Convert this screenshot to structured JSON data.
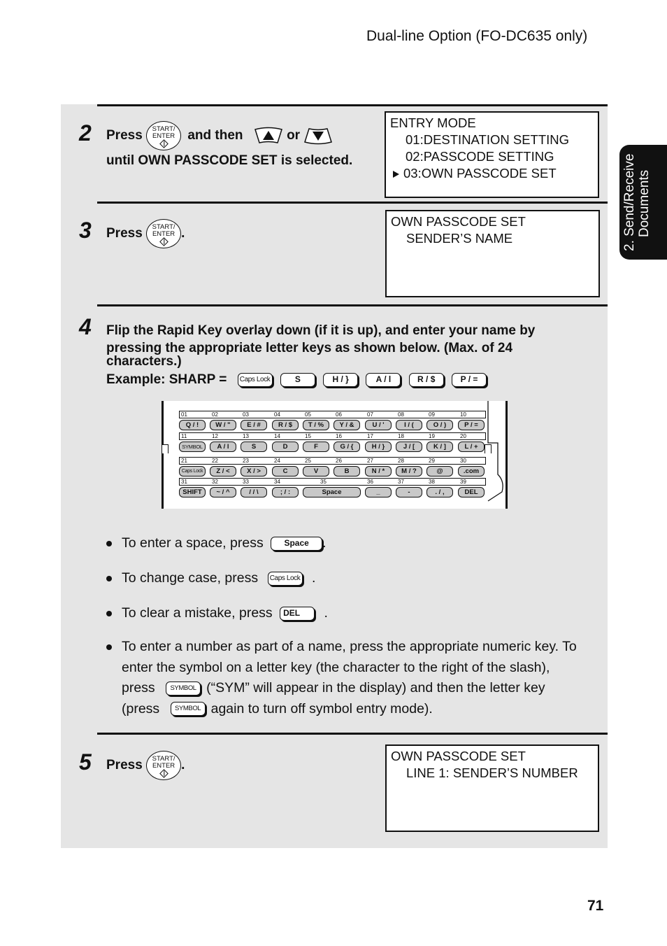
{
  "header": {
    "title": "Dual-line Option (FO-DC635 only)"
  },
  "side_tab": {
    "line1": "2. Send/Receive",
    "line2": "Documents"
  },
  "page_number": "71",
  "steps": [
    {
      "number": "2",
      "text_press": "Press",
      "start_key": {
        "line1": "START/",
        "line2": "ENTER"
      },
      "text_and_then": "and then",
      "text_or": "or",
      "text_line2": "until OWN PASSCODE SET is selected.",
      "display": {
        "line1": "ENTRY MODE",
        "line2": "01:DESTINATION SETTING",
        "line3": "02:PASSCODE SETTING",
        "line4": "03:OWN PASSCODE SET"
      }
    },
    {
      "number": "3",
      "text_press": "Press",
      "start_key": {
        "line1": "START/",
        "line2": "ENTER"
      },
      "period": ".",
      "display": {
        "line1": "OWN PASSCODE SET",
        "line2": "SENDER’S NAME"
      }
    },
    {
      "number": "4",
      "text": "Flip the Rapid Key overlay down (if it is up), and enter your name by pressing the appropriate letter keys as shown below. (Max. of 24 characters.)",
      "text_line1": "Flip the Rapid Key overlay down (if it is up), and enter your name by",
      "text_line2": "pressing the appropriate letter keys as shown below. (Max. of 24",
      "text_line3": "characters.)",
      "example_label": "Example: SHARP =",
      "example_keys": [
        "Caps Lock",
        "S",
        "H / }",
        "A / l",
        "R / $",
        "P / ="
      ]
    },
    {
      "number": "5",
      "text_press": "Press",
      "start_key": {
        "line1": "START/",
        "line2": "ENTER"
      },
      "period": ".",
      "display": {
        "line1": "OWN PASSCODE SET",
        "line2": "LINE 1: SENDER’S NUMBER"
      }
    }
  ],
  "keyboard": {
    "rows": [
      {
        "numbers": [
          "01",
          "02",
          "03",
          "04",
          "05",
          "06",
          "07",
          "08",
          "09",
          "10"
        ],
        "keys": [
          "Q / !",
          "W / \"",
          "E / #",
          "R / $",
          "T / %",
          "Y / &",
          "U / '",
          "I / (",
          "O / )",
          "P / ="
        ]
      },
      {
        "numbers": [
          "11",
          "12",
          "13",
          "14",
          "15",
          "16",
          "17",
          "18",
          "19",
          "20"
        ],
        "keys": [
          "SYMBOL",
          "A / l",
          "S",
          "D",
          "F",
          "G / {",
          "H / }",
          "J / [",
          "K / ]",
          "L / +"
        ]
      },
      {
        "numbers": [
          "21",
          "22",
          "23",
          "24",
          "25",
          "26",
          "27",
          "28",
          "29",
          "30"
        ],
        "keys": [
          "Caps Lock",
          "Z / <",
          "X / >",
          "C",
          "V",
          "B",
          "N / *",
          "M / ?",
          "@",
          ".com"
        ]
      },
      {
        "numbers": [
          "31",
          "32",
          "33",
          "34",
          "35",
          "36",
          "37",
          "38",
          "39"
        ],
        "keys": [
          "SHIFT",
          "~ / ^",
          "/ / \\",
          "; / :",
          "Space",
          "_",
          "-",
          ". / ,",
          "DEL"
        ]
      }
    ]
  },
  "bullets": [
    {
      "text": "To enter a space, press",
      "key": "Space",
      "after": "."
    },
    {
      "text": "To change case, press",
      "key": "Caps Lock",
      "after": "."
    },
    {
      "text": "To clear a mistake, press",
      "key": "DEL",
      "after": "."
    },
    {
      "line1": "To enter a number as part of a name, press the appropriate numeric key. To",
      "line2": "enter the symbol on a letter key (the character to the right of the slash),",
      "line3_a": "press",
      "key": "SYMBOL",
      "line3_b": "(“SYM” will appear in the display) and then the letter key",
      "line4_a": "(press",
      "line4_b": "again to turn off symbol entry mode)."
    }
  ],
  "colors": {
    "panel_bg": "#e5e5e5",
    "key_gray": "#c8c8c8",
    "tab_bg": "#111111",
    "text": "#111111"
  }
}
